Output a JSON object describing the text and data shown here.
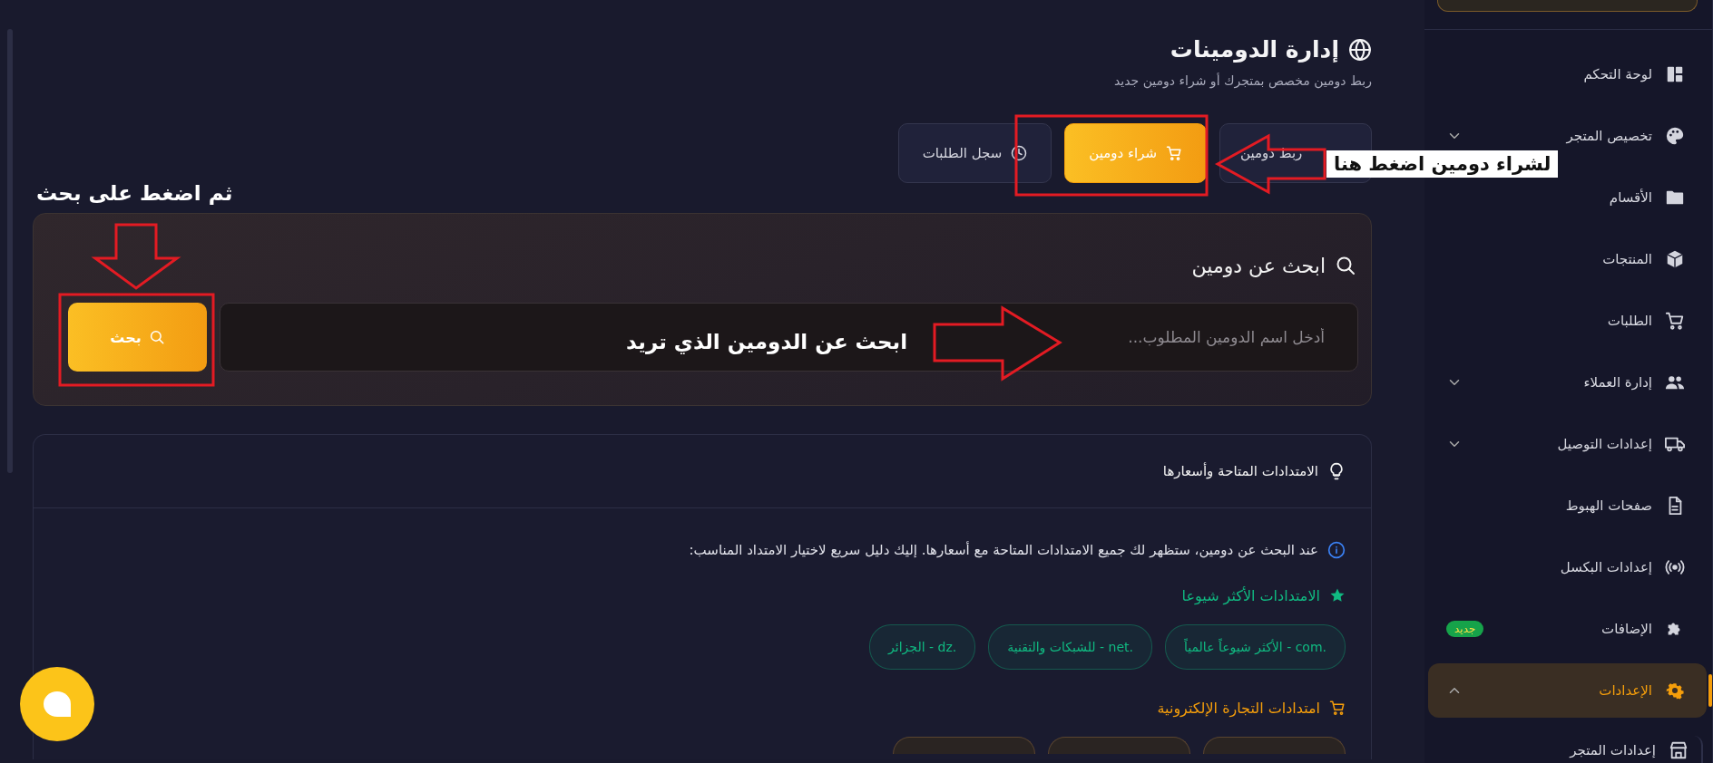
{
  "header": {
    "title": "إدارة الدومينات",
    "subtitle": "ربط دومين مخصص بمتجرك أو شراء دومين جديد"
  },
  "actions": [
    {
      "label": "ربط دومين",
      "selected": false,
      "kind": "link"
    },
    {
      "label": "شراء دومين",
      "selected": true,
      "kind": "buy"
    },
    {
      "label": "سجل الطلبات",
      "selected": false,
      "kind": "history"
    }
  ],
  "search": {
    "title": "ابحث عن دومين",
    "placeholder": "أدخل اسم الدومين المطلوب...",
    "button": "بحث"
  },
  "extensions": {
    "title": "الامتدادات المتاحة وأسعارها",
    "info": "عند البحث عن دومين، ستظهر لك جميع الامتدادات المتاحة مع أسعارها. إليك دليل سريع لاختيار الامتداد المناسب:",
    "groups": [
      {
        "title": "الامتدادات الأكثر شيوعا",
        "color": "#10b981",
        "chips": [
          ".com - الأكثر شيوعاً عالمياً",
          ".net - للشبكات والتقنية",
          ".dz - الجزائر"
        ]
      },
      {
        "title": "امتدادات التجارة الإلكترونية",
        "color": "#f59e0b"
      }
    ]
  },
  "sidebar": {
    "items": [
      {
        "label": "لوحة التحكم",
        "kind": "link",
        "selected": false
      },
      {
        "label": "تخصيص المتجر",
        "kind": "group",
        "selected": false,
        "expanded": false
      },
      {
        "label": "الأقسام",
        "kind": "link",
        "selected": false
      },
      {
        "label": "المنتجات",
        "kind": "link",
        "selected": false
      },
      {
        "label": "الطلبات",
        "kind": "link",
        "selected": false
      },
      {
        "label": "إدارة العملاء",
        "kind": "group",
        "selected": false,
        "expanded": false
      },
      {
        "label": "إعدادات التوصيل",
        "kind": "group",
        "selected": false,
        "expanded": false
      },
      {
        "label": "صفحات الهبوط",
        "kind": "link",
        "selected": false
      },
      {
        "label": "إعدادات البكسل",
        "kind": "link",
        "selected": false
      },
      {
        "label": "الإضافات",
        "kind": "link",
        "selected": false,
        "badge": "جديد"
      },
      {
        "label": "الإعدادات",
        "kind": "group",
        "selected": true,
        "expanded": true,
        "children": [
          {
            "label": "إعدادات المتجر",
            "kind": "link",
            "selected": false
          }
        ]
      }
    ]
  },
  "annotations": [
    {
      "kind": "callout",
      "text": "لشراء دومين اضغط هنا"
    },
    {
      "kind": "note",
      "text": "ثم اضغط على بحث"
    },
    {
      "kind": "note",
      "text": "ابحث عن الدومين الذي تريد"
    }
  ]
}
